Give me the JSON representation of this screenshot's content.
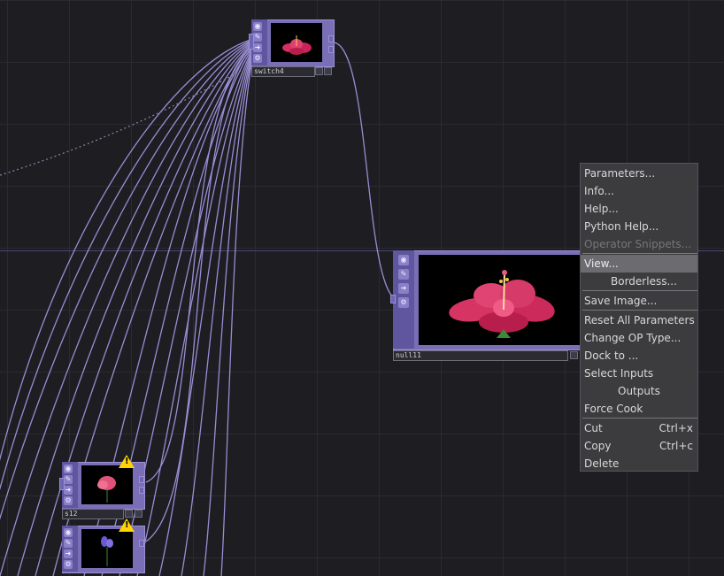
{
  "nodes": {
    "switch": {
      "name": "switch4",
      "side_icons": [
        "display-icon",
        "pin-icon",
        "arrow-icon",
        "gear-icon"
      ]
    },
    "null": {
      "name": "null11",
      "side_icons": [
        "display-icon",
        "pin-icon",
        "arrow-icon",
        "gear-icon"
      ]
    },
    "s12": {
      "name": "s12",
      "warning": "!",
      "side_icons": [
        "display-icon",
        "pin-icon",
        "arrow-icon",
        "gear-icon"
      ]
    },
    "s13": {
      "name": "",
      "warning": "!",
      "side_icons": [
        "display-icon",
        "pin-icon",
        "arrow-icon",
        "gear-icon"
      ]
    }
  },
  "side_glyphs": {
    "display": "◉",
    "pin": "✎",
    "arrow": "➜",
    "gear": "⚙"
  },
  "context_menu": {
    "parameters": "Parameters...",
    "info": "Info...",
    "help": "Help...",
    "python_help": "Python Help...",
    "operator_snippets": "Operator Snippets...",
    "view": "View...",
    "borderless": "Borderless...",
    "save_image": "Save Image...",
    "reset_all": "Reset All Parameters",
    "change_op_type": "Change OP Type...",
    "dock_to": "Dock to ...",
    "select_inputs": "Select Inputs",
    "outputs": "Outputs",
    "force_cook": "Force Cook",
    "cut": "Cut",
    "cut_shortcut": "Ctrl+x",
    "copy": "Copy",
    "copy_shortcut": "Ctrl+c",
    "delete": "Delete"
  },
  "colors": {
    "background": "#1d1d22",
    "node_frame": "#7a6fb6",
    "wire": "#a79ae6",
    "menu_bg": "#3c3c3e",
    "menu_highlight": "#6c6c70",
    "warning": "#ffd400"
  }
}
